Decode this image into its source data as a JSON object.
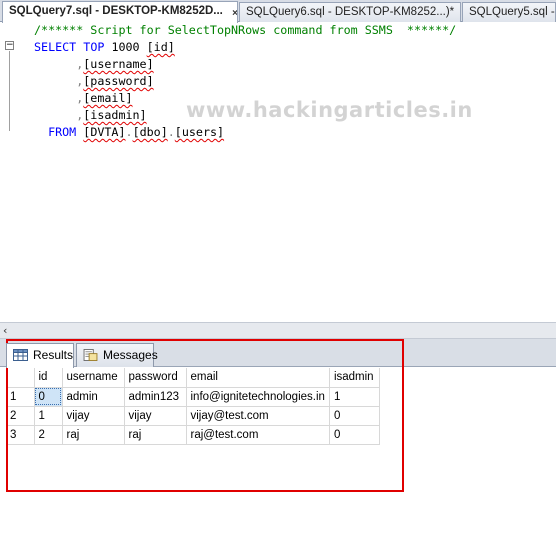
{
  "tabs": [
    {
      "label": "SQLQuery7.sql - DESKTOP-KM8252D...",
      "active": true
    },
    {
      "label": "SQLQuery6.sql - DESKTOP-KM8252...)*",
      "active": false
    },
    {
      "label": "SQLQuery5.sql -",
      "active": false
    }
  ],
  "tab_close_glyph": "×",
  "editor": {
    "lines": [
      {
        "parts": [
          {
            "t": "/****** Script for SelectTopNRows command from SSMS  ******/",
            "c": "comment"
          }
        ]
      },
      {
        "parts": [
          {
            "t": "SELECT",
            "c": "kw"
          },
          {
            "t": " ",
            "c": "plain"
          },
          {
            "t": "TOP",
            "c": "kw"
          },
          {
            "t": " 1000 ",
            "c": "plain"
          },
          {
            "t": "[id]",
            "c": "plain",
            "squig": true
          }
        ]
      },
      {
        "parts": [
          {
            "t": "      ,",
            "c": "gray"
          },
          {
            "t": "[username]",
            "c": "plain",
            "squig": true
          }
        ]
      },
      {
        "parts": [
          {
            "t": "      ,",
            "c": "gray"
          },
          {
            "t": "[password]",
            "c": "plain",
            "squig": true
          }
        ]
      },
      {
        "parts": [
          {
            "t": "      ,",
            "c": "gray"
          },
          {
            "t": "[email]",
            "c": "plain",
            "squig": true
          }
        ]
      },
      {
        "parts": [
          {
            "t": "      ,",
            "c": "gray"
          },
          {
            "t": "[isadmin]",
            "c": "plain",
            "squig": true
          }
        ]
      },
      {
        "parts": [
          {
            "t": "  FROM",
            "c": "kw"
          },
          {
            "t": " ",
            "c": "plain"
          },
          {
            "t": "[DVTA]",
            "c": "plain",
            "squig": true
          },
          {
            "t": ".",
            "c": "gray"
          },
          {
            "t": "[dbo]",
            "c": "plain",
            "squig": true
          },
          {
            "t": ".",
            "c": "gray"
          },
          {
            "t": "[users]",
            "c": "plain",
            "squig": true
          }
        ]
      }
    ],
    "watermark": "www.hackingarticles.in",
    "collapse_glyph": "−"
  },
  "scroll_left_glyph": "‹",
  "results": {
    "tabs": [
      {
        "label": "Results",
        "icon": "grid-icon",
        "active": true
      },
      {
        "label": "Messages",
        "icon": "messages-icon",
        "active": false
      }
    ],
    "columns": [
      "",
      "id",
      "username",
      "password",
      "email",
      "isadmin"
    ],
    "rows": [
      [
        "1",
        "0",
        "admin",
        "admin123",
        "info@ignitetechnologies.in",
        "1"
      ],
      [
        "2",
        "1",
        "vijay",
        "vijay",
        "vijay@test.com",
        "0"
      ],
      [
        "3",
        "2",
        "raj",
        "raj",
        "raj@test.com",
        "0"
      ]
    ]
  },
  "colors": {
    "comment": "#008000",
    "keyword": "#0000ff",
    "highlight_frame": "#e00000",
    "selected_cell": "#cfe4f7"
  }
}
